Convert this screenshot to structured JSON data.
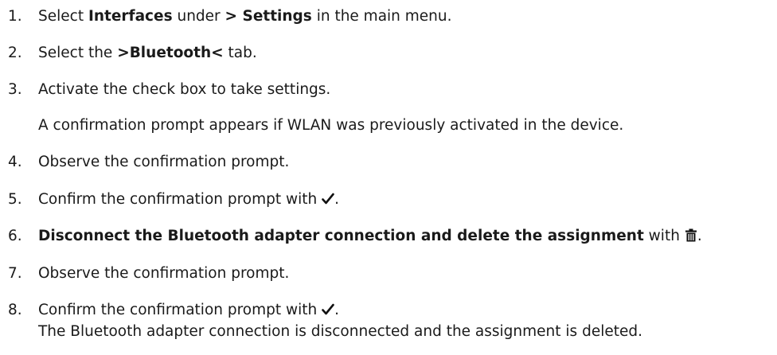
{
  "steps": [
    {
      "number": "1.",
      "pre": "Select ",
      "bold1": "Interfaces",
      "mid": " under ",
      "bold2": "> Settings",
      "post": " in the main menu."
    },
    {
      "number": "2.",
      "pre": "Select the ",
      "bold": ">Bluetooth<",
      "post": " tab."
    },
    {
      "number": "3.",
      "text": "Activate the check box to take settings.",
      "note": "A confirmation prompt appears if WLAN was previously activated in the device."
    },
    {
      "number": "4.",
      "text": "Observe the confirmation prompt."
    },
    {
      "number": "5.",
      "pre": "Confirm the confirmation prompt with ",
      "icon": "checkmark-icon",
      "post": "."
    },
    {
      "number": "6.",
      "bold": "Disconnect the Bluetooth adapter connection and delete the assignment",
      "mid": " with ",
      "icon": "trash-icon",
      "post": "."
    },
    {
      "number": "7.",
      "text": "Observe the confirmation prompt."
    },
    {
      "number": "8.",
      "pre": "Confirm the confirmation prompt with ",
      "icon": "checkmark-icon",
      "post": ".",
      "result": "The Bluetooth adapter connection is disconnected and the assignment is deleted."
    }
  ]
}
